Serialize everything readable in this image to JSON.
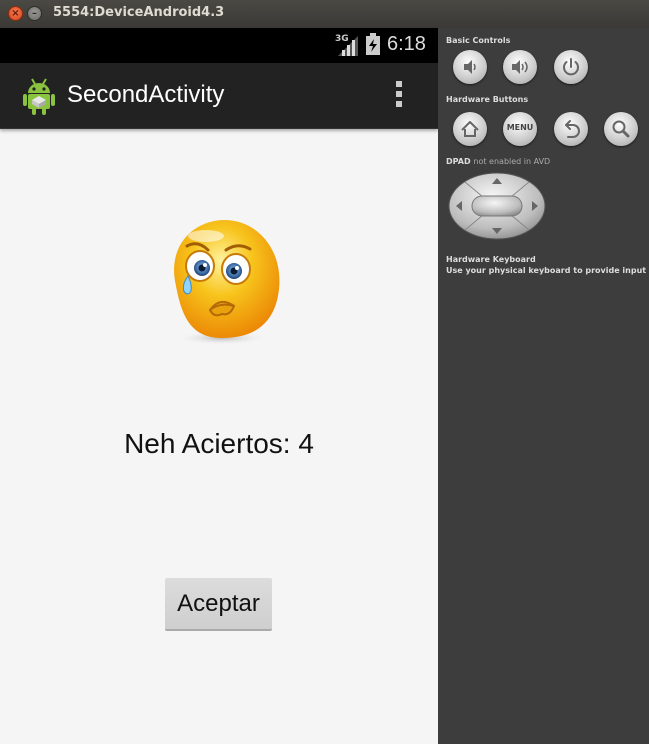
{
  "window": {
    "title": "5554:DeviceAndroid4.3",
    "controls": [
      "close-icon",
      "minimize-icon"
    ]
  },
  "status_bar": {
    "network": "3G",
    "time": "6:18"
  },
  "action_bar": {
    "title": "SecondActivity",
    "app_icon": "android-robot-icon",
    "overflow_icon": "overflow-menu-icon"
  },
  "content": {
    "emoji": "crying-face-icon",
    "result_text": "Neh Aciertos: 4",
    "accept_button": "Aceptar"
  },
  "panel": {
    "basic_controls": {
      "title": "Basic Controls",
      "buttons": [
        "volume-down-icon",
        "volume-up-icon",
        "power-icon"
      ]
    },
    "hardware_buttons": {
      "title": "Hardware Buttons",
      "buttons": [
        "home-icon",
        "menu-button",
        "back-icon",
        "search-icon"
      ],
      "menu_label": "MENU"
    },
    "dpad": {
      "title_prefix": "DPAD",
      "title_suffix": "not enabled in AVD"
    },
    "keyboard": {
      "title": "Hardware Keyboard",
      "subtitle": "Use your physical keyboard to provide input"
    }
  },
  "colors": {
    "action_bar": "#222222",
    "screen_background": "#f5f5f5",
    "panel_background": "#3d3d3d",
    "emoji_yellow": "#f7c41c"
  }
}
